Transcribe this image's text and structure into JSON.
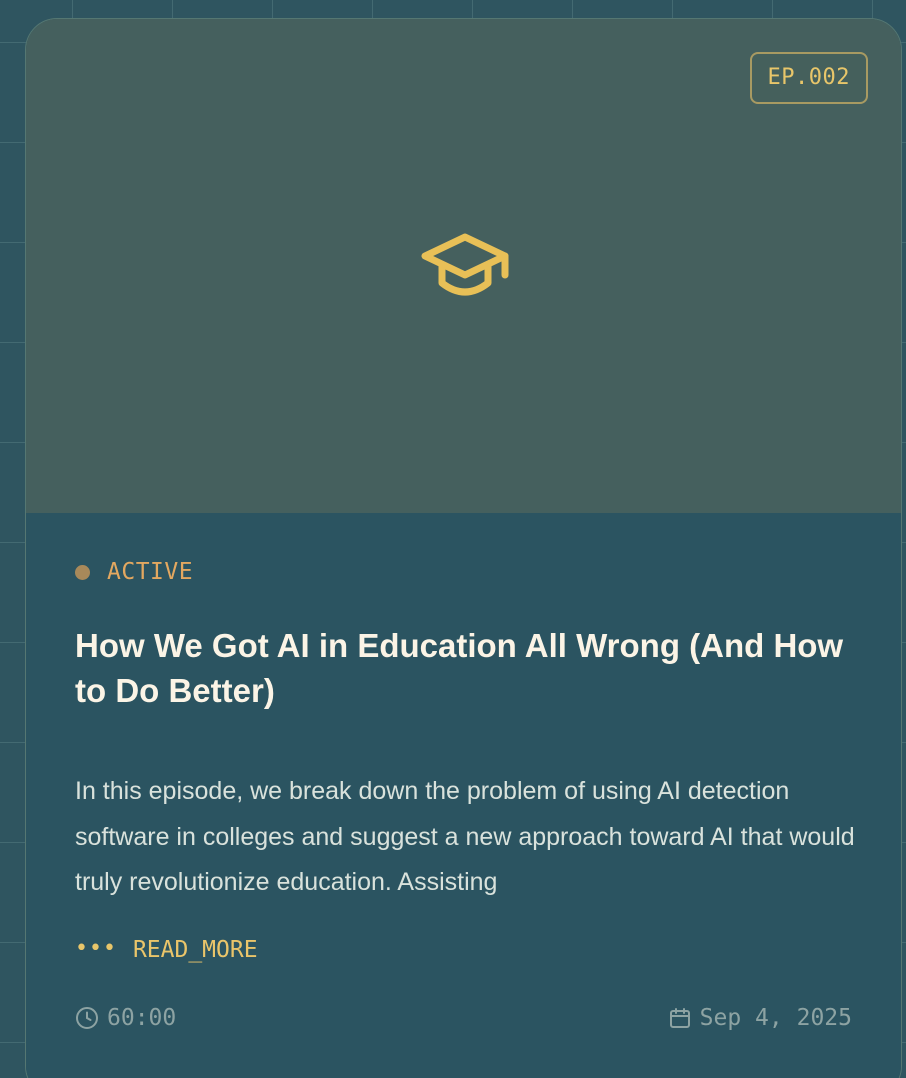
{
  "episode": {
    "badge": "EP.002",
    "thumbnail_icon": "graduation-cap-icon",
    "status": "ACTIVE",
    "title": "How We Got AI in Education All Wrong (And How to Do Better)",
    "description": "In this episode, we break down the problem of using AI detection software in colleges and suggest a new approach toward AI that would truly revolutionize education. Assisting",
    "read_more_label": "READ_MORE",
    "duration": "60:00",
    "date": "Sep 4, 2025"
  },
  "colors": {
    "accent": "#e8c66a",
    "status": "#e3a860",
    "background": "#2b5461"
  }
}
